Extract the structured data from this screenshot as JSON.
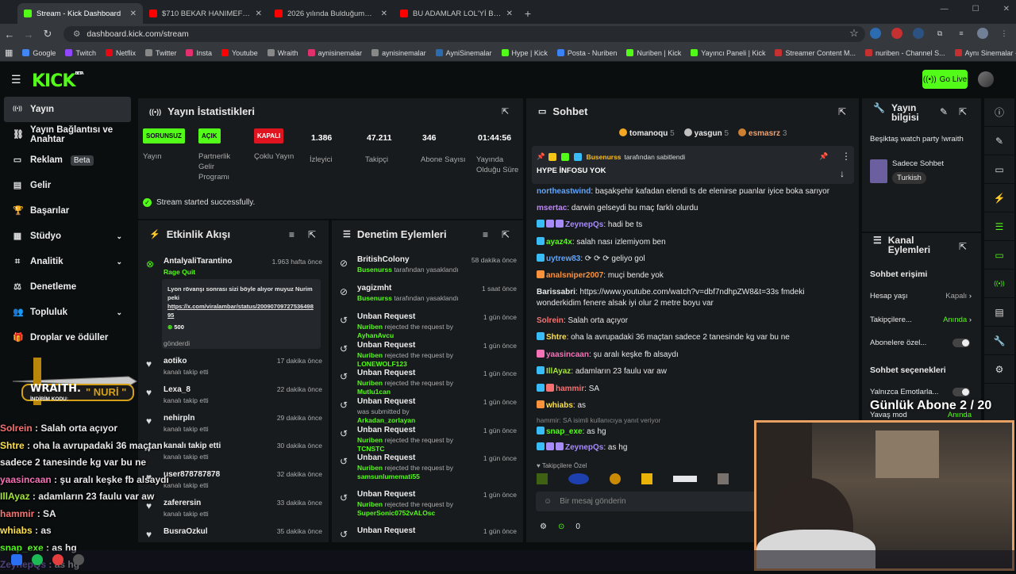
{
  "tabs": [
    {
      "title": "Stream - Kick Dashboard",
      "active": true,
      "color": "#53fc18"
    },
    {
      "title": "$710 BEKAR HANIMEFENDİNİN",
      "active": false,
      "color": "#ff0000"
    },
    {
      "title": "2026 yılında Bulduğumuz en iyi",
      "active": false,
      "color": "#ff0000"
    },
    {
      "title": "BU ADAMLAR LOL'Yİ BU SEFER",
      "active": false,
      "color": "#ff0000"
    }
  ],
  "url": "dashboard.kick.com/stream",
  "bookmarks": [
    "Google",
    "Twitch",
    "Netflix",
    "Twitter",
    "Insta",
    "Youtube",
    "Wraith",
    "aynisinemalar",
    "aynisinemalar",
    "AyniSinemalar",
    "Hype | Kick",
    "Posta - Nuriben",
    "Nuriben | Kick",
    "Yayıncı Paneli | Kick",
    "Streamer Content M...",
    "nuriben - Channel S...",
    "Aynı Sinemalar - Ça..."
  ],
  "header": {
    "logo": "KICK",
    "beta": "BETA",
    "go_live": "Go Live"
  },
  "sidebar": {
    "items": [
      {
        "label": "Yayın",
        "icon": "broadcast-icon",
        "active": true
      },
      {
        "label": "Yayın Bağlantısı ve Anahtar",
        "icon": "link-icon"
      },
      {
        "label": "Reklam",
        "icon": "ad-icon",
        "badge": "Beta"
      },
      {
        "label": "Gelir",
        "icon": "money-icon"
      },
      {
        "label": "Başarılar",
        "icon": "trophy-icon"
      },
      {
        "label": "Stüdyo",
        "icon": "studio-icon",
        "chevron": true
      },
      {
        "label": "Analitik",
        "icon": "analytics-icon",
        "chevron": true
      },
      {
        "label": "Denetleme",
        "icon": "mod-icon"
      },
      {
        "label": "Topluluk",
        "icon": "community-icon",
        "chevron": true
      },
      {
        "label": "Droplar ve ödüller",
        "icon": "gift-icon"
      }
    ]
  },
  "stats": {
    "title": "Yayın İstatistikleri",
    "cols": [
      {
        "pill": "SORUNSUZ",
        "pill_color": "#53fc18",
        "label": "Yayın"
      },
      {
        "pill": "AÇIK",
        "pill_color": "#53fc18",
        "label": "Partnerlik Gelir Programı"
      },
      {
        "pill": "KAPALI",
        "pill_color": "#e0141e",
        "label": "Çoklu Yayın"
      },
      {
        "num": "1.386",
        "label": "İzleyici"
      },
      {
        "num": "47.211",
        "label": "Takipçi"
      },
      {
        "num": "346",
        "label": "Abone Sayısı"
      },
      {
        "num": "01:44:56",
        "label": "Yayında Olduğu Süre"
      }
    ],
    "status": "Stream started successfully."
  },
  "activity": {
    "title": "Etkinlik Akışı",
    "first": {
      "name": "AntalyaliTarantino",
      "time": "1.963 hafta önce",
      "sub": "Rage Quit",
      "msg": "Lyon rövanşı sonrası sizi böyle alıyor muyuz Nurim peki",
      "link": "https://x.com/viralambar/status/2009070972753649895",
      "amount": "500",
      "footer": "gönderdi"
    },
    "items": [
      {
        "name": "aotiko",
        "time": "17 dakika önce",
        "sub": "kanalı takip etti"
      },
      {
        "name": "Lexa_8",
        "time": "22 dakika önce",
        "sub": "kanalı takip etti"
      },
      {
        "name": "nehirpln",
        "time": "29 dakika önce",
        "sub": "kanalı takip etti"
      },
      {
        "name": "kanalı takip etti",
        "time": "30 dakika önce",
        "sub": "kanalı takip etti"
      },
      {
        "name": "user878787878",
        "time": "32 dakika önce",
        "sub": "kanalı takip etti"
      },
      {
        "name": "zaferersin",
        "time": "33 dakika önce",
        "sub": "kanalı takip etti"
      },
      {
        "name": "BusraOzkul",
        "time": "35 dakika önce",
        "sub": ""
      }
    ]
  },
  "moderation": {
    "title": "Denetim Eylemleri",
    "items": [
      {
        "name": "BritishColony",
        "time": "58 dakika önce",
        "who": "Busenurss",
        "rest": "tarafından yasaklandı",
        "icon": "ban"
      },
      {
        "name": "yagizmht",
        "time": "1 saat önce",
        "who": "Busenurss",
        "rest": "tarafından yasaklandı",
        "icon": "ban"
      },
      {
        "name": "Unban Request",
        "time": "1 gün önce",
        "who": "Nuriben",
        "rest": "rejected the request by",
        "target": "AyhanAvcu",
        "icon": "undo"
      },
      {
        "name": "Unban Request",
        "time": "1 gün önce",
        "who": "Nuriben",
        "rest": "rejected the request by",
        "target": "LONEWOLF123",
        "icon": "undo"
      },
      {
        "name": "Unban Request",
        "time": "1 gün önce",
        "who": "Nuriben",
        "rest": "rejected the request by",
        "target": "Mutlu1can",
        "icon": "undo"
      },
      {
        "name": "Unban Request",
        "time": "1 gün önce",
        "who": "",
        "rest": "was submitted by",
        "target": "Arkadan_zorlayan",
        "icon": "undo"
      },
      {
        "name": "Unban Request",
        "time": "1 gün önce",
        "who": "Nuriben",
        "rest": "rejected the request by",
        "target": "TCNSTC",
        "icon": "undo"
      },
      {
        "name": "Unban Request",
        "time": "1 gün önce",
        "who": "Nuriben",
        "rest": "rejected the request by",
        "target": "samsunlumemati55",
        "icon": "undo"
      },
      {
        "name": "Unban Request",
        "time": "1 gün önce",
        "who": "Nuriben",
        "rest": "rejected the request by",
        "target": "SuperSonic0752vALOsc",
        "icon": "undo"
      },
      {
        "name": "Unban Request",
        "time": "1 gün önce",
        "who": "",
        "rest": "",
        "target": "",
        "icon": "undo"
      }
    ]
  },
  "chat": {
    "title": "Sohbet",
    "top": [
      {
        "name": "tomanoqu",
        "n": "5"
      },
      {
        "name": "yasgun",
        "n": "5"
      },
      {
        "name": "esmasrz",
        "n": "3"
      }
    ],
    "pinned_by": "Busenurss",
    "pinned_rest": "tarafından sabitlendi",
    "pinned_msg": "HYPE İNFOSU YOK",
    "messages": [
      {
        "u": "northeastwind",
        "c": "#60a5fa",
        "t": "başakşehir kafadan elendi ts de elenirse puanlar iyice boka sarıyor"
      },
      {
        "u": "msertac",
        "c": "#c084fc",
        "t": "darwin gelseydi bu maç farklı olurdu"
      },
      {
        "u": "ZeynepQs",
        "c": "#a78bfa",
        "t": "hadi be ts"
      },
      {
        "u": "ayaz4x",
        "c": "#53fc18",
        "t": "salah nası izlemiyom ben"
      },
      {
        "u": "uytrew83",
        "c": "#60a5fa",
        "t": "⟳ ⟳ ⟳ geliyo gol"
      },
      {
        "u": "analsniper2007",
        "c": "#fb923c",
        "t": "muçi bende yok"
      },
      {
        "u": "Barissabri",
        "c": "#e8e8e8",
        "t": "https://www.youtube.com/watch?v=dbf7ndhpZW8&t=33s fmdeki wonderkidim fenere alsak iyi olur 2 metre boyu var"
      },
      {
        "u": "Solrein",
        "c": "#f87171",
        "t": "Salah orta açıyor"
      },
      {
        "u": "Shtre",
        "c": "#fde047",
        "t": "oha la avrupadaki 36 maçtan sadece 2 tanesinde kg var bu ne"
      },
      {
        "u": "yaasincaan",
        "c": "#f472b6",
        "t": "şu aralı keşke fb alsaydı"
      },
      {
        "u": "IllAyaz",
        "c": "#a3e635",
        "t": "adamların 23 faulu var aw"
      },
      {
        "u": "hammir",
        "c": "#f87171",
        "t": "SA"
      },
      {
        "u": "whiabs",
        "c": "#fde047",
        "t": "as"
      },
      {
        "u": "snap_exe",
        "c": "#53fc18",
        "t": "as hg"
      },
      {
        "u": "ZeynepQs",
        "c": "#a78bfa",
        "t": "as hg"
      }
    ],
    "reply_hint": "hammir: SA isimli kullanıcıya yanıt veriyor",
    "followers_only": "Takipçilere Özel",
    "placeholder": "Bir mesaj gönderin",
    "points": "0"
  },
  "stream_info": {
    "title": "Yayın bilgisi",
    "desc": "Beşiktaş watch party !wraith",
    "category": "Sadece Sohbet",
    "lang": "Turkish"
  },
  "channel_actions": {
    "title": "Kanal Eylemleri",
    "chat_access": "Sohbet erişimi",
    "account_age": "Hesap yaşı",
    "account_age_val": "Kapalı",
    "followers": "Takipçilere...",
    "followers_val": "Anında",
    "subs": "Abonelere özel...",
    "chat_options": "Sohbet seçenekleri",
    "emotes": "Yalnızca Emotlarla...",
    "slow": "Yavaş mod",
    "slow_val": "Anında"
  },
  "overlay": {
    "brand": "WRAITH.",
    "code_label": "İNDİRİM KODU:",
    "code": "NURİ",
    "sub_goal": "Günlük Abone 2 / 20",
    "lines": [
      {
        "u": "Solrein",
        "c": "#f87171",
        "t": "Salah orta açıyor"
      },
      {
        "u": "Shtre",
        "c": "#fde047",
        "t": "oha la avrupadaki 36 maçtan sadece 2 tanesinde kg var bu ne"
      },
      {
        "u": "yaasincaan",
        "c": "#f472b6",
        "t": "şu aralı keşke fb alsaydı"
      },
      {
        "u": "IllAyaz",
        "c": "#a3e635",
        "t": "adamların 23 faulu var aw"
      },
      {
        "u": "hammir",
        "c": "#f87171",
        "t": "SA"
      },
      {
        "u": "whiabs",
        "c": "#fde047",
        "t": "as"
      },
      {
        "u": "snap_exe",
        "c": "#53fc18",
        "t": "as hg"
      },
      {
        "u": "ZeynepQs",
        "c": "#a78bfa",
        "t": "as hg"
      }
    ]
  }
}
